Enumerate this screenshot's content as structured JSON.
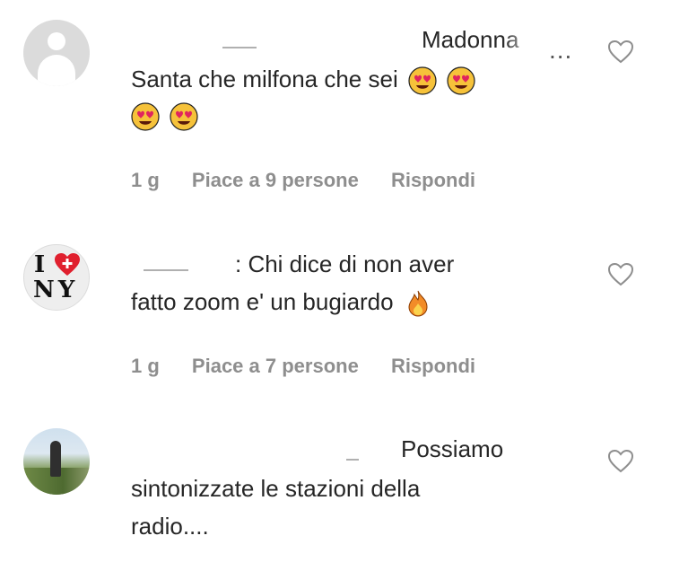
{
  "comments": [
    {
      "username_tail": "Madonna",
      "text_line1": "Santa che milfona che sei",
      "text_line2": "",
      "time": "1 g",
      "likes": "Piace a 9 persone",
      "reply_label": "Rispondi",
      "more_label": "..."
    },
    {
      "text_line1": ": Chi dice di non aver",
      "text_line2": "fatto zoom e' un bugiardo",
      "time": "1 g",
      "likes": "Piace a 7 persone",
      "reply_label": "Rispondi"
    },
    {
      "text_line1": "Possiamo",
      "text_line2": "sintonizzate le stazioni della",
      "text_line3": "radio...."
    }
  ],
  "avatar_ny": {
    "letter": "I",
    "city": "NY"
  },
  "colors": {
    "meta": "#8e8e8e",
    "text": "#262626",
    "heart_outline": "#8e8e8e",
    "emoji_face": "#f6c23a",
    "emoji_heart": "#e0245e",
    "fire": "#f28c28"
  },
  "icons": [
    "heart-outline-icon",
    "heart-eyes-emoji",
    "fire-emoji",
    "more-icon"
  ]
}
